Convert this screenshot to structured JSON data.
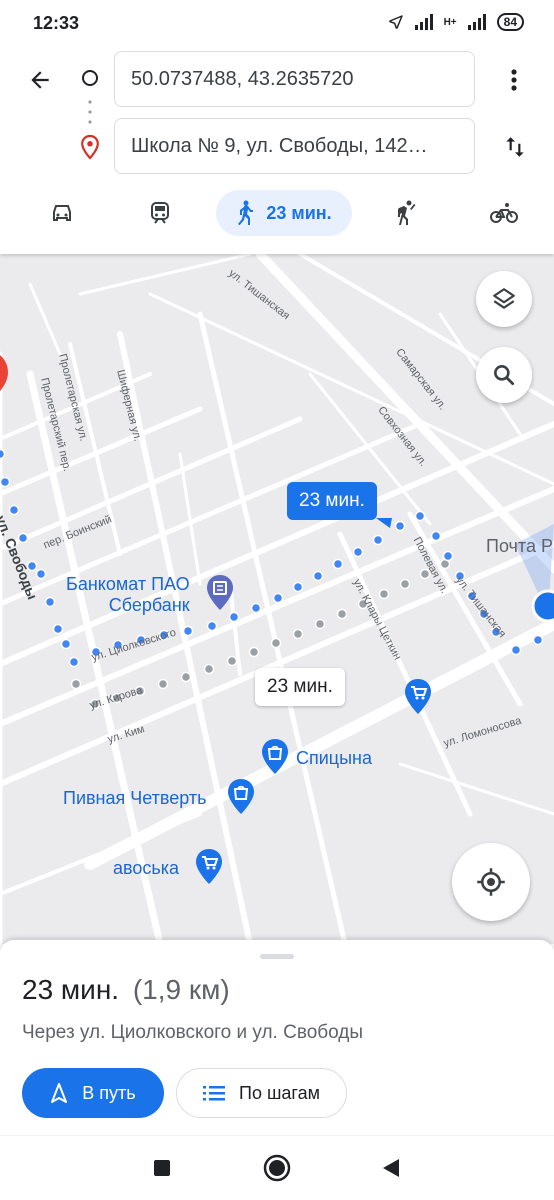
{
  "status_bar": {
    "time": "12:33",
    "network": "H+",
    "battery": "84"
  },
  "header": {
    "origin_value": "50.0737488, 43.2635720",
    "destination_value": "Школа № 9, ул. Свободы, 142…",
    "modes": [
      {
        "name": "car"
      },
      {
        "name": "transit"
      },
      {
        "name": "walk",
        "label": "23 мин."
      },
      {
        "name": "rideshare"
      },
      {
        "name": "bicycle"
      }
    ]
  },
  "map": {
    "route_chips": {
      "selected": "23 мин.",
      "alternative": "23 мин."
    },
    "pois": {
      "atm": "Банкомат ПАО\nСбербанк",
      "post": "Почта Р",
      "spitsyna": "Спицына",
      "beer": "Пивная Четверть",
      "avoska": "авоська"
    },
    "streets": [
      "ул. Тишанская",
      "Самарская ул.",
      "Совхозная ул.",
      "Пролетарская ул.",
      "Пролетарский пер.",
      "Шиферная ул.",
      "пер. Боинский",
      "ул. Свободы",
      "ул. Циолковского",
      "ул. Клары Цеткин",
      "Полевая ул.",
      "ул. Тишанская",
      "ул. Кирова",
      "ул. Ким",
      "ул. Ломоносова"
    ],
    "colors": {
      "route": "#4285f4",
      "alt_route": "#9aa0a6",
      "selected_chip": "#1a73e8"
    }
  },
  "sheet": {
    "duration": "23 мин.",
    "distance": "(1,9 км)",
    "via": "Через ул. Циолковского и ул. Свободы",
    "start_button": "В путь",
    "steps_button": "По шагам"
  },
  "navbar": {
    "icons": [
      "stop-square-icon",
      "home-circle-icon",
      "back-triangle-icon"
    ]
  }
}
